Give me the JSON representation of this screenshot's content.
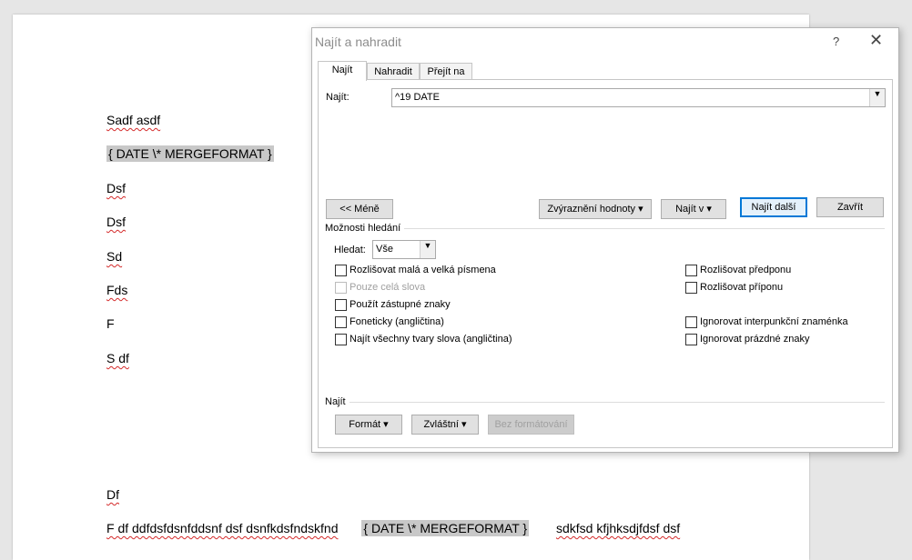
{
  "document": {
    "lines": [
      "Sadf asdf",
      "Dsf",
      "Dsf",
      "Sd",
      "Fds",
      "F",
      "S df",
      "Df"
    ],
    "field_code": "{ DATE   \\* MERGEFORMAT }",
    "last_line_start": "F df ddfdsfdsnfddsnf dsf dsnfkdsfndskfnd",
    "last_line_end": "sdkfsd kfjhksdjfdsf dsf"
  },
  "dialog": {
    "title": "Najít a nahradit",
    "help": "?",
    "close": "✕",
    "tabs": [
      "Najít",
      "Nahradit",
      "Přejít na"
    ],
    "find_label": "Najít:",
    "find_value": "^19 DATE",
    "buttons": {
      "less": "<< Méně",
      "highlight": "Zvýraznění hodnoty ▾",
      "find_in": "Najít v ▾",
      "find_next": "Najít další",
      "close": "Zavřít"
    },
    "options_label": "Možnosti hledání",
    "search_label": "Hledat:",
    "search_value": "Vše",
    "options_left": [
      {
        "label": "Rozlišovat malá a velká písmena",
        "disabled": false
      },
      {
        "label": "Pouze celá slova",
        "disabled": true
      },
      {
        "label": "Použít zástupné znaky",
        "disabled": false
      },
      {
        "label": "Foneticky (angličtina)",
        "disabled": false
      },
      {
        "label": "Najít všechny tvary slova (angličtina)",
        "disabled": false
      }
    ],
    "options_right": [
      {
        "label": "Rozlišovat předponu"
      },
      {
        "label": "Rozlišovat příponu"
      },
      {
        "label": "Ignorovat interpunkční znaménka"
      },
      {
        "label": "Ignorovat prázdné znaky"
      }
    ],
    "find_section_label": "Najít",
    "format_buttons": {
      "format": "Formát ▾",
      "special": "Zvláštní ▾",
      "no_format": "Bez formátování"
    },
    "colors": {
      "accent": "#0078d7",
      "field_shading": "#c8c8c8"
    }
  }
}
